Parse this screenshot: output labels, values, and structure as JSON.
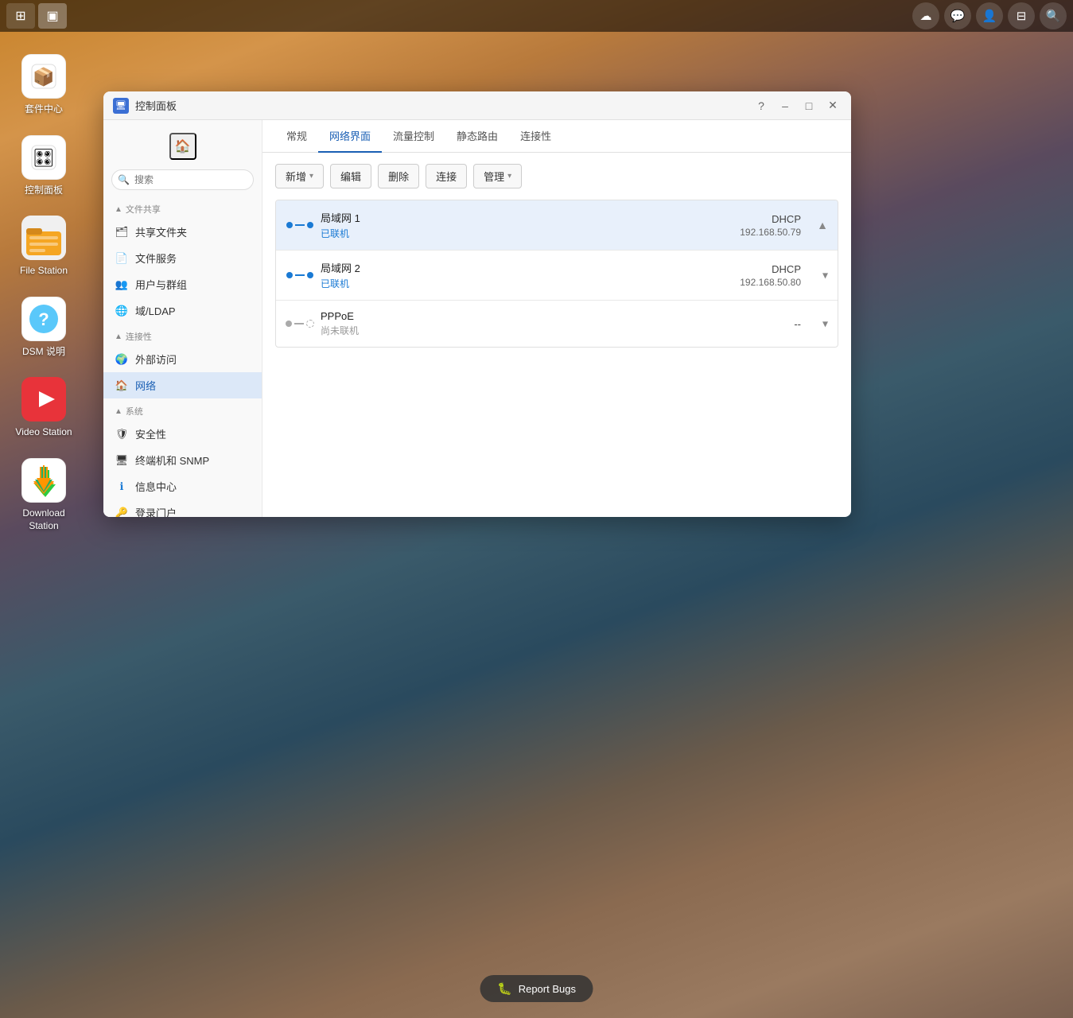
{
  "desktop": {
    "bg": "canyon"
  },
  "taskbar": {
    "left_buttons": [
      {
        "label": "⊞",
        "id": "grid",
        "active": false
      },
      {
        "label": "▣",
        "id": "window",
        "active": true
      }
    ],
    "right_icons": [
      {
        "name": "cloud-icon",
        "symbol": "☁"
      },
      {
        "name": "chat-icon",
        "symbol": "💬"
      },
      {
        "name": "user-icon",
        "symbol": "👤"
      },
      {
        "name": "window-icon",
        "symbol": "⊟"
      },
      {
        "name": "search-icon",
        "symbol": "🔍"
      }
    ]
  },
  "desktop_icons": [
    {
      "id": "package",
      "label": "套件中心",
      "emoji": "📦",
      "color": "#fff",
      "text_color": "#333"
    },
    {
      "id": "control",
      "label": "控制面板",
      "emoji": "🎛",
      "color": "#fff",
      "text_color": "#333"
    },
    {
      "id": "filestation",
      "label": "File Station",
      "emoji": "📁",
      "color": "#f5a623"
    },
    {
      "id": "dsm",
      "label": "DSM 说明",
      "emoji": "❓",
      "color": "#5ac8fa"
    },
    {
      "id": "videostation",
      "label": "Video Station",
      "emoji": "▶",
      "color": "#e8333a"
    },
    {
      "id": "downloadstation",
      "label": "Download Station",
      "emoji": "⬇",
      "color": "#fff"
    }
  ],
  "window": {
    "title": "控制面板",
    "icon_color": "#3b6fd4",
    "tabs": [
      {
        "id": "general",
        "label": "常规",
        "active": false
      },
      {
        "id": "network",
        "label": "网络界面",
        "active": true
      },
      {
        "id": "traffic",
        "label": "流量控制",
        "active": false
      },
      {
        "id": "static-route",
        "label": "静态路由",
        "active": false
      },
      {
        "id": "connectivity",
        "label": "连接性",
        "active": false
      }
    ],
    "toolbar": {
      "buttons": [
        {
          "id": "new",
          "label": "新增",
          "dropdown": true
        },
        {
          "id": "edit",
          "label": "编辑",
          "dropdown": false
        },
        {
          "id": "delete",
          "label": "删除",
          "dropdown": false,
          "disabled": false
        },
        {
          "id": "connect",
          "label": "连接",
          "dropdown": false
        },
        {
          "id": "manage",
          "label": "管理",
          "dropdown": true
        }
      ]
    },
    "network_interfaces": [
      {
        "id": "lan1",
        "name": "局域网 1",
        "status": "已联机",
        "type": "DHCP",
        "ip": "192.168.50.79",
        "connected": true,
        "selected": true,
        "expanded": true
      },
      {
        "id": "lan2",
        "name": "局域网 2",
        "status": "已联机",
        "type": "DHCP",
        "ip": "192.168.50.80",
        "connected": true,
        "selected": false,
        "expanded": false
      },
      {
        "id": "pppoe",
        "name": "PPPoE",
        "status": "尚未联机",
        "type": "--",
        "ip": "",
        "connected": false,
        "selected": false,
        "expanded": false
      }
    ],
    "sidebar": {
      "search_placeholder": "搜索",
      "sections": [
        {
          "id": "file-sharing",
          "label": "文件共享",
          "items": [
            {
              "id": "shared-folder",
              "label": "共享文件夹",
              "icon": "🗂",
              "color": "#f5a623"
            },
            {
              "id": "file-service",
              "label": "文件服务",
              "icon": "📄",
              "color": "#5ac8fa"
            },
            {
              "id": "user-group",
              "label": "用户与群组",
              "icon": "👥",
              "color": "#5ac8fa"
            },
            {
              "id": "domain",
              "label": "域/LDAP",
              "icon": "🌐",
              "color": "#5ac8fa"
            }
          ]
        },
        {
          "id": "connectivity",
          "label": "连接性",
          "items": [
            {
              "id": "external-access",
              "label": "外部访问",
              "icon": "🌍",
              "color": "#5ac8fa"
            },
            {
              "id": "network",
              "label": "网络",
              "icon": "🏠",
              "color": "#5ac8fa",
              "active": true
            }
          ]
        },
        {
          "id": "system",
          "label": "系统",
          "items": [
            {
              "id": "security",
              "label": "安全性",
              "icon": "🛡",
              "color": "#5ac8fa"
            },
            {
              "id": "terminal-snmp",
              "label": "终端机和 SNMP",
              "icon": "🖥",
              "color": "#5ac8fa"
            },
            {
              "id": "info-center",
              "label": "信息中心",
              "icon": "ℹ",
              "color": "#1a7ad4"
            },
            {
              "id": "login-portal",
              "label": "登录门户",
              "icon": "🔑",
              "color": "#a855f7"
            }
          ]
        }
      ]
    }
  },
  "report_bugs": {
    "label": "Report Bugs",
    "icon": "🐛"
  }
}
